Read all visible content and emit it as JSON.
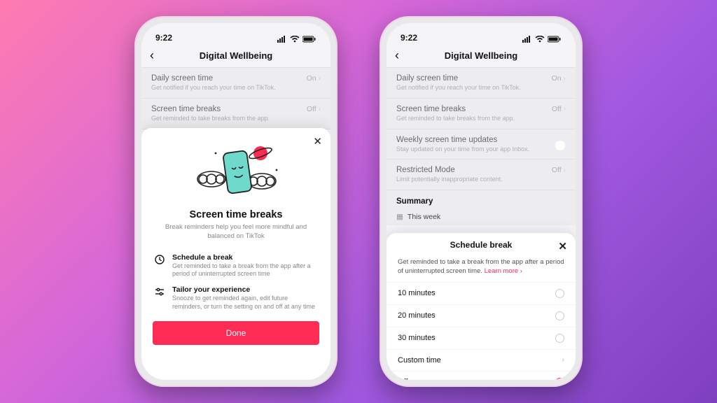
{
  "statusbar": {
    "time": "9:22"
  },
  "nav": {
    "title": "Digital Wellbeing"
  },
  "phone1": {
    "rows": [
      {
        "title": "Daily screen time",
        "sub": "Get notified if you reach your time on TikTok.",
        "val": "On"
      },
      {
        "title": "Screen time breaks",
        "sub": "Get reminded to take breaks from the app.",
        "val": "Off"
      }
    ],
    "sheet": {
      "title": "Screen time breaks",
      "desc": "Break reminders help you feel more mindful and balanced on TikTok",
      "feat1": {
        "title": "Schedule a break",
        "sub": "Get reminded to take a break from the app after a period of uninterrupted screen time"
      },
      "feat2": {
        "title": "Tailor your experience",
        "sub": "Snooze to get reminded again, edit future reminders, or turn the setting on and off at any time"
      },
      "done": "Done"
    }
  },
  "phone2": {
    "rows": [
      {
        "title": "Daily screen time",
        "sub": "Get notified if you reach your time on TikTok.",
        "val": "On"
      },
      {
        "title": "Screen time breaks",
        "sub": "Get reminded to take breaks from the app.",
        "val": "Off"
      },
      {
        "title": "Weekly screen time updates",
        "sub": "Stay updated on your time from your app Inbox."
      },
      {
        "title": "Restricted Mode",
        "sub": "Limit potentially inappropriate content.",
        "val": "Off"
      }
    ],
    "summary": {
      "header": "Summary",
      "week": "This week"
    },
    "sheet": {
      "title": "Schedule break",
      "desc": "Get reminded to take a break from the app after a period of uninterrupted screen time. ",
      "learn": "Learn more",
      "options": [
        "10 minutes",
        "20 minutes",
        "30 minutes",
        "Custom time",
        "Off"
      ],
      "selected": 4
    }
  }
}
